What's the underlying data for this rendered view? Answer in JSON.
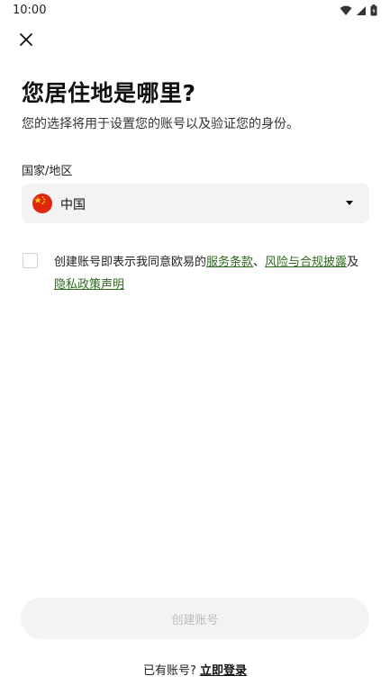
{
  "status_bar": {
    "time": "10:00"
  },
  "header": {
    "close_icon": "close-icon",
    "title": "您居住地是哪里?",
    "subtitle": "您的选择将用于设置您的账号以及验证您的身份。"
  },
  "country_field": {
    "label": "国家/地区",
    "value": "中国",
    "flag_icon": "china-flag-icon",
    "dropdown_icon": "caret-down-icon"
  },
  "terms": {
    "checked": false,
    "prefix": "创建账号即表示我同意欧易的",
    "link1": "服务条款",
    "sep": "、",
    "link2": "风险与合规披露",
    "and": "及",
    "link3": "隐私政策声明"
  },
  "actions": {
    "create_label": "创建账号",
    "login_prompt": "已有账号?",
    "login_link": "立即登录"
  },
  "colors": {
    "link": "#2e6b1e",
    "button_disabled_bg": "#f3f3f3",
    "button_disabled_text": "#bdbdbd",
    "select_bg": "#f3f3f3"
  }
}
